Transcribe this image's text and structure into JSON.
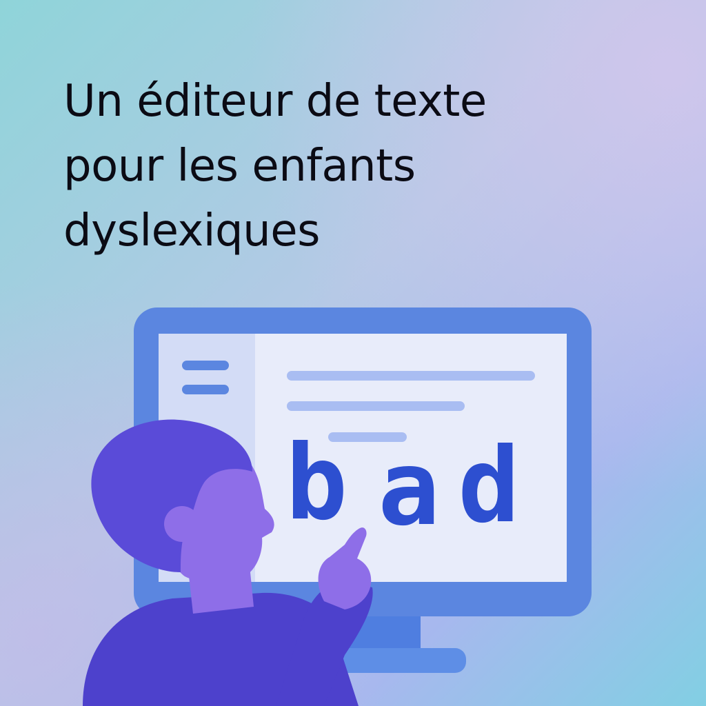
{
  "title": {
    "lines": [
      "Un éditeur de texte",
      "pour les enfants",
      "dyslexiques"
    ]
  },
  "screen": {
    "word_letters": [
      "b",
      "a",
      "d"
    ]
  },
  "colors": {
    "background_top_left": "#8fd3dc",
    "background_top_right": "#c9c3ea",
    "background_bottom_right": "#86d0e6",
    "monitor": "#5b86e0",
    "screen": "#e8ecfa",
    "sidebar": "#d3dcf6",
    "text_bars": "#a9bdf2",
    "word": "#2d4fd0",
    "child_hair": "#5a4bd8",
    "child_skin": "#8e6ee8",
    "child_shirt": "#4d41cc"
  }
}
